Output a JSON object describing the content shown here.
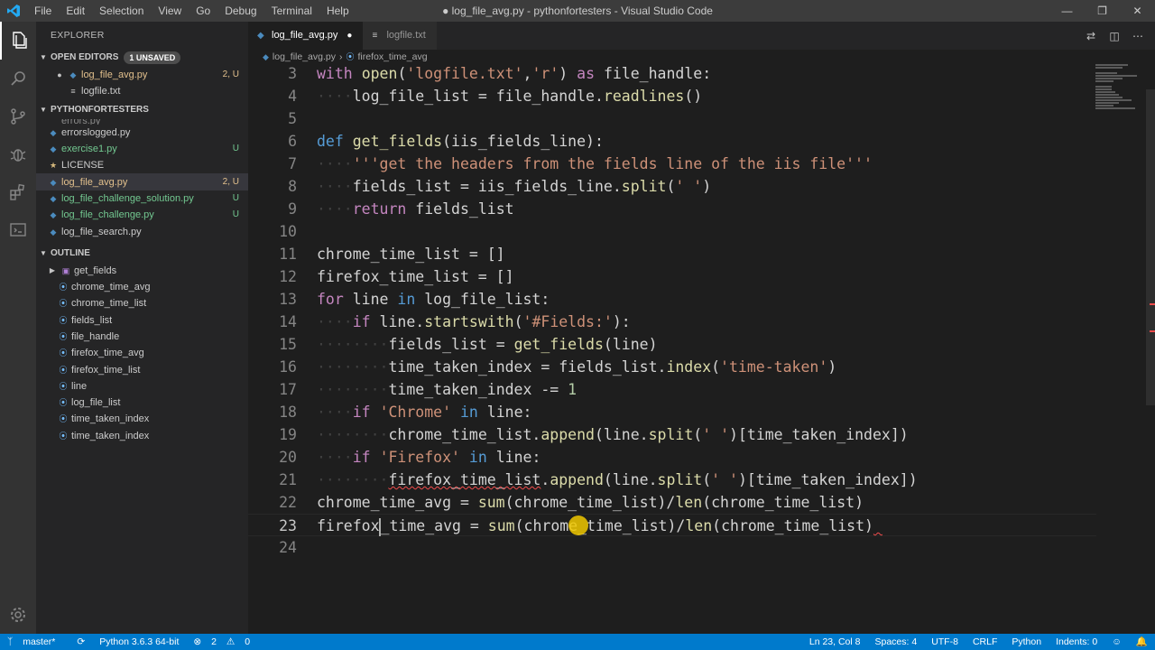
{
  "window": {
    "title": "● log_file_avg.py - pythonfortesters - Visual Studio Code",
    "menu": [
      "File",
      "Edit",
      "Selection",
      "View",
      "Go",
      "Debug",
      "Terminal",
      "Help"
    ]
  },
  "sidebar": {
    "header": "EXPLORER",
    "open_editors": {
      "label": "OPEN EDITORS",
      "badge": "1 UNSAVED",
      "items": [
        {
          "name": "log_file_avg.py",
          "status": "2, U"
        },
        {
          "name": "logfile.txt",
          "status": ""
        }
      ]
    },
    "project": {
      "label": "PYTHONFORTESTERS",
      "partial": "errors.py",
      "items": [
        {
          "name": "errorslogged.py",
          "status": "",
          "kind": "py"
        },
        {
          "name": "exercise1.py",
          "status": "U",
          "kind": "py"
        },
        {
          "name": "LICENSE",
          "status": "",
          "kind": "license"
        },
        {
          "name": "log_file_avg.py",
          "status": "2, U",
          "kind": "py"
        },
        {
          "name": "log_file_challenge_solution.py",
          "status": "U",
          "kind": "py"
        },
        {
          "name": "log_file_challenge.py",
          "status": "U",
          "kind": "py"
        },
        {
          "name": "log_file_search.py",
          "status": "",
          "kind": "py"
        }
      ]
    },
    "outline": {
      "label": "OUTLINE",
      "items": [
        "get_fields",
        "chrome_time_avg",
        "chrome_time_list",
        "fields_list",
        "file_handle",
        "firefox_time_avg",
        "firefox_time_list",
        "line",
        "log_file_list",
        "time_taken_index",
        "time_taken_index"
      ]
    }
  },
  "tabs": [
    {
      "label": "log_file_avg.py",
      "dirty": "●"
    },
    {
      "label": "logfile.txt",
      "dirty": ""
    }
  ],
  "breadcrumb": {
    "file": "log_file_avg.py",
    "sep": "›",
    "symbol": "firefox_time_avg"
  },
  "status": {
    "branch": "master*",
    "python": "Python 3.6.3 64-bit",
    "errors": "2",
    "warnings": "0",
    "position": "Ln 23, Col 8",
    "spaces": "Spaces: 4",
    "encoding": "UTF-8",
    "eol": "CRLF",
    "language": "Python",
    "indents": "Indents: 0"
  },
  "colors": {
    "accent": "#007acc",
    "modified": "#e2c08d",
    "untracked": "#73c991",
    "error": "#f14c4c"
  }
}
